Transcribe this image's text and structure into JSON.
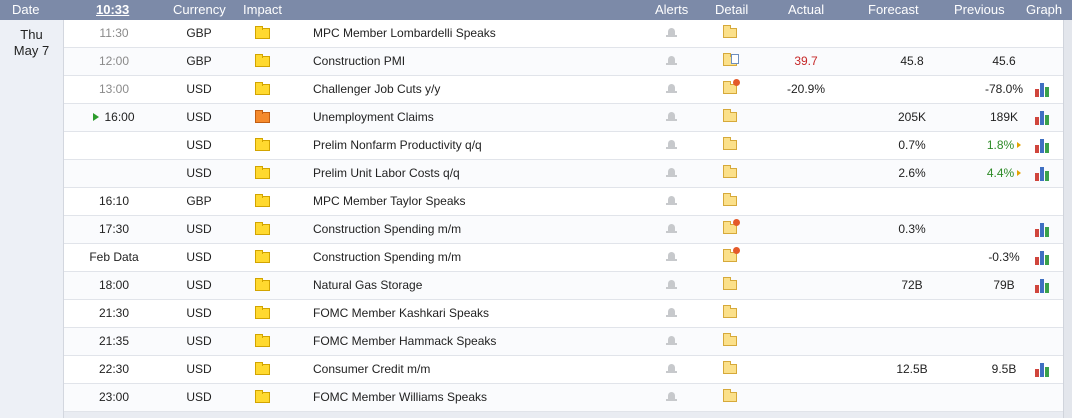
{
  "header": {
    "date": "Date",
    "time": "10:33",
    "currency": "Currency",
    "impact": "Impact",
    "alerts": "Alerts",
    "detail": "Detail",
    "actual": "Actual",
    "forecast": "Forecast",
    "previous": "Previous",
    "graph": "Graph"
  },
  "date_cell": {
    "day": "Thu",
    "date": "May 7"
  },
  "colors": {
    "header_bg": "#7c8aa8",
    "low_impact": "#ffd92f",
    "medium_impact": "#f58a2c",
    "actual_worse": "#c62828",
    "revised_better": "#2e8b28"
  },
  "events": [
    {
      "time": "11:30",
      "past": true,
      "currency": "GBP",
      "impact": "low",
      "event": "MPC Member Lombardelli Speaks",
      "detail": "folder-icon",
      "actual": "",
      "forecast": "",
      "previous": "",
      "graph": false
    },
    {
      "time": "12:00",
      "past": true,
      "currency": "GBP",
      "impact": "low",
      "event": "Construction PMI",
      "detail": "folder-doc-icon",
      "actual": "39.7",
      "actual_color": "red",
      "forecast": "45.8",
      "previous": "45.6",
      "graph": false
    },
    {
      "time": "13:00",
      "past": true,
      "currency": "USD",
      "impact": "low",
      "event": "Challenger Job Cuts y/y",
      "detail": "folder-new-icon",
      "actual": "-20.9%",
      "forecast": "",
      "previous": "-78.0%",
      "graph": true
    },
    {
      "time": "16:00",
      "past": false,
      "next": true,
      "currency": "USD",
      "impact": "medium",
      "event": "Unemployment Claims",
      "detail": "folder-icon",
      "actual": "",
      "forecast": "205K",
      "previous": "189K",
      "graph": true
    },
    {
      "time": "",
      "past": false,
      "currency": "USD",
      "impact": "low",
      "event": "Prelim Nonfarm Productivity q/q",
      "detail": "folder-icon",
      "actual": "",
      "forecast": "0.7%",
      "previous": "1.8%",
      "previous_color": "green",
      "revised": true,
      "graph": true
    },
    {
      "time": "",
      "past": false,
      "currency": "USD",
      "impact": "low",
      "event": "Prelim Unit Labor Costs q/q",
      "detail": "folder-icon",
      "actual": "",
      "forecast": "2.6%",
      "previous": "4.4%",
      "previous_color": "green",
      "revised": true,
      "graph": true
    },
    {
      "time": "16:10",
      "past": false,
      "currency": "GBP",
      "impact": "low",
      "event": "MPC Member Taylor Speaks",
      "detail": "folder-icon",
      "actual": "",
      "forecast": "",
      "previous": "",
      "graph": false
    },
    {
      "time": "17:30",
      "past": false,
      "currency": "USD",
      "impact": "low",
      "event": "Construction Spending m/m",
      "detail": "folder-new-icon",
      "actual": "",
      "forecast": "0.3%",
      "previous": "",
      "graph": true
    },
    {
      "time": "Feb Data",
      "past": false,
      "currency": "USD",
      "impact": "low",
      "event": "Construction Spending m/m",
      "detail": "folder-new-icon",
      "actual": "",
      "forecast": "",
      "previous": "-0.3%",
      "graph": true
    },
    {
      "time": "18:00",
      "past": false,
      "currency": "USD",
      "impact": "low",
      "event": "Natural Gas Storage",
      "detail": "folder-icon",
      "actual": "",
      "forecast": "72B",
      "previous": "79B",
      "graph": true
    },
    {
      "time": "21:30",
      "past": false,
      "currency": "USD",
      "impact": "low",
      "event": "FOMC Member Kashkari Speaks",
      "detail": "folder-icon",
      "actual": "",
      "forecast": "",
      "previous": "",
      "graph": false
    },
    {
      "time": "21:35",
      "past": false,
      "currency": "USD",
      "impact": "low",
      "event": "FOMC Member Hammack Speaks",
      "detail": "folder-icon",
      "actual": "",
      "forecast": "",
      "previous": "",
      "graph": false
    },
    {
      "time": "22:30",
      "past": false,
      "currency": "USD",
      "impact": "low",
      "event": "Consumer Credit m/m",
      "detail": "folder-icon",
      "actual": "",
      "forecast": "12.5B",
      "previous": "9.5B",
      "graph": true
    },
    {
      "time": "23:00",
      "past": false,
      "currency": "USD",
      "impact": "low",
      "event": "FOMC Member Williams Speaks",
      "detail": "folder-icon",
      "actual": "",
      "forecast": "",
      "previous": "",
      "graph": false
    }
  ]
}
